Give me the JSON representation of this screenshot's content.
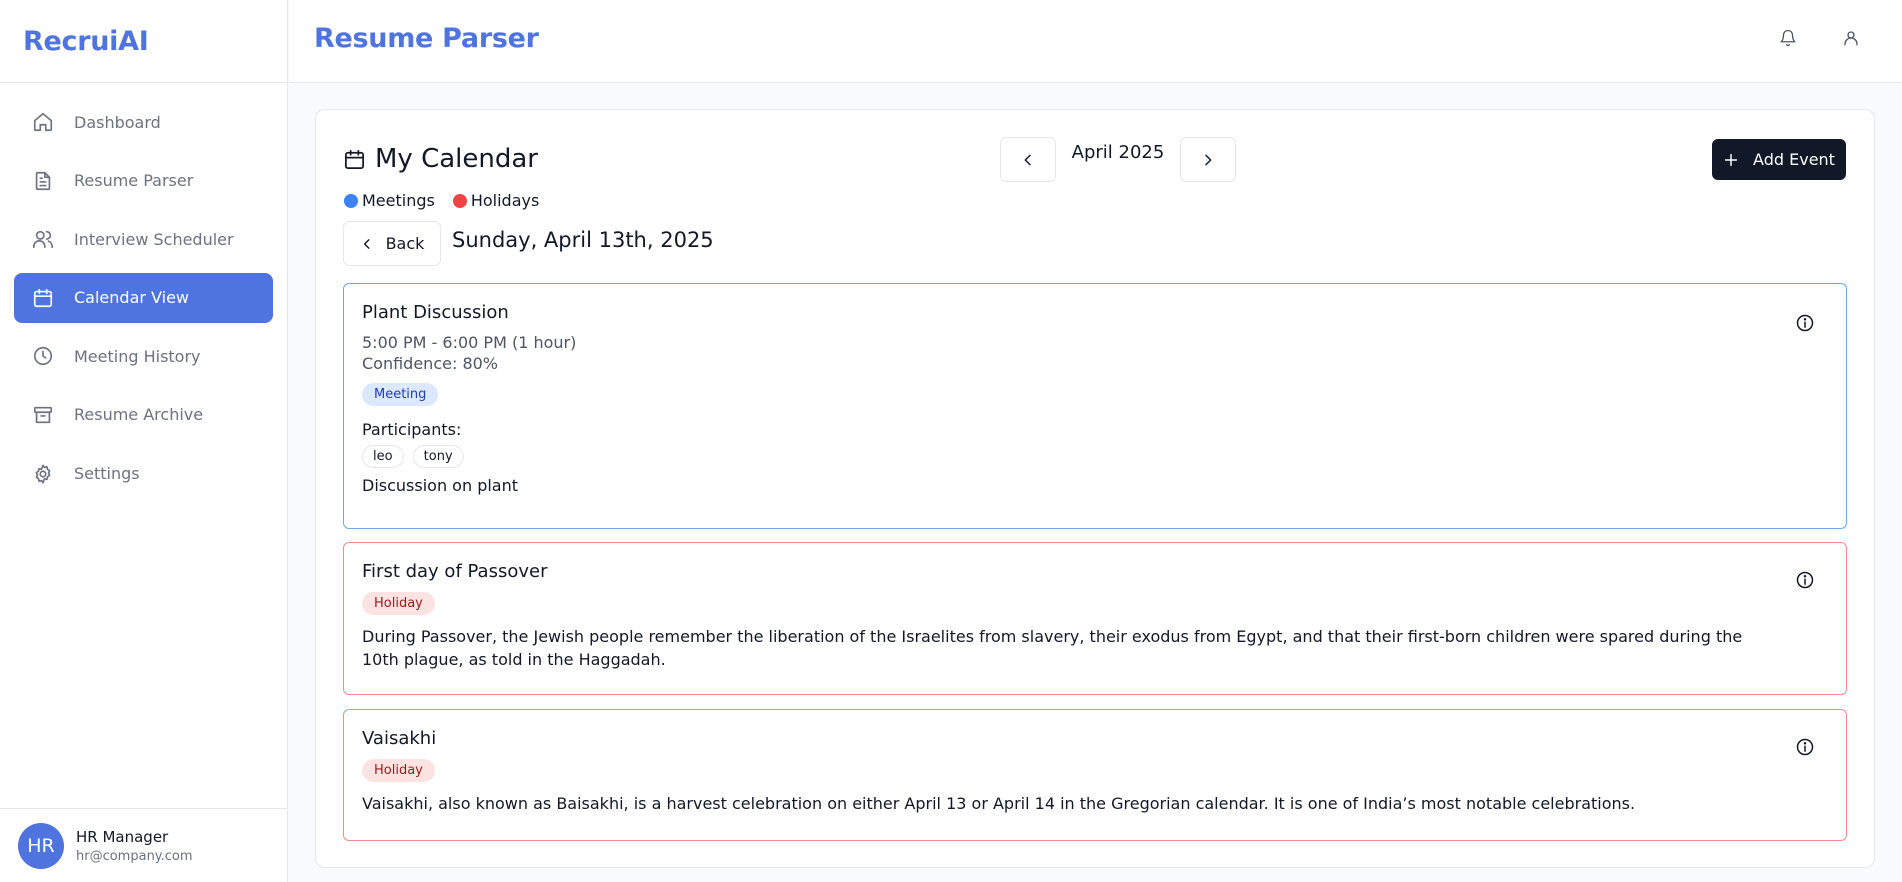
{
  "app": {
    "brand": "RecruiAI"
  },
  "header": {
    "title": "Resume Parser"
  },
  "sidebar": {
    "items": [
      {
        "label": "Dashboard",
        "icon": "home-icon"
      },
      {
        "label": "Resume Parser",
        "icon": "file-text-icon"
      },
      {
        "label": "Interview Scheduler",
        "icon": "users-icon"
      },
      {
        "label": "Calendar View",
        "icon": "calendar-icon",
        "active": true
      },
      {
        "label": "Meeting History",
        "icon": "clock-icon"
      },
      {
        "label": "Resume Archive",
        "icon": "archive-icon"
      },
      {
        "label": "Settings",
        "icon": "gear-icon"
      }
    ],
    "user": {
      "initials": "HR",
      "name": "HR Manager",
      "email": "hr@company.com"
    }
  },
  "calendar": {
    "title": "My Calendar",
    "month": "April 2025",
    "add_label": "Add Event",
    "legend": [
      {
        "label": "Meetings",
        "color": "#3b82f6"
      },
      {
        "label": "Holidays",
        "color": "#ef4444"
      }
    ],
    "back_label": "Back",
    "date_heading": "Sunday, April 13th, 2025"
  },
  "events": [
    {
      "type": "meeting",
      "title": "Plant Discussion",
      "time": "5:00 PM - 6:00 PM (1 hour)",
      "confidence": "Confidence: 80%",
      "badge": "Meeting",
      "participants_label": "Participants:",
      "participants": [
        "leo",
        "tony"
      ],
      "description": "Discussion on plant"
    },
    {
      "type": "holiday",
      "title": "First day of Passover",
      "badge": "Holiday",
      "description": "During Passover, the Jewish people remember the liberation of the Israelites from slavery, their exodus from Egypt, and that their first-born children were spared during the 10th plague, as told in the Haggadah."
    },
    {
      "type": "holiday",
      "title": "Vaisakhi",
      "badge": "Holiday",
      "description": "Vaisakhi, also known as Baisakhi, is a harvest celebration on either April 13 or April 14 in the Gregorian calendar. It is one of India’s most notable celebrations."
    }
  ],
  "colors": {
    "accent": "#4f74e0",
    "dark_button": "#111827",
    "meeting_border": "#6ba9e8",
    "holiday_border": "#f28b8b"
  }
}
